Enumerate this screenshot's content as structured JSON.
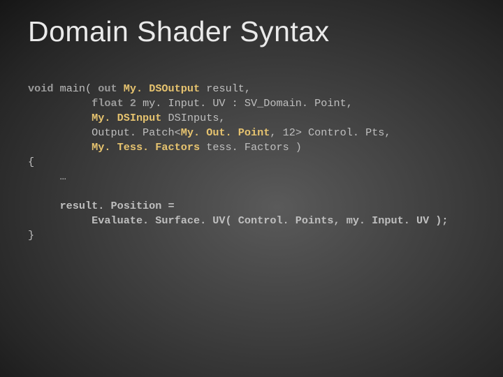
{
  "title": "Domain Shader Syntax",
  "code": {
    "l1a": "void",
    "l1b": " main( ",
    "l1c": "out ",
    "l1d": "My. DSOutput",
    "l1e": " result,",
    "l2a": "          ",
    "l2b": "float 2",
    "l2c": " my. Input. UV : SV_Domain. Point,",
    "l3a": "          ",
    "l3b": "My. DSInput",
    "l3c": " DSInputs,",
    "l4a": "          Output. Patch<",
    "l4b": "My. Out. Point",
    "l4c": ", 12> Control. Pts,",
    "l5a": "          ",
    "l5b": "My. Tess. Factors",
    "l5c": " tess. Factors )",
    "l6": "{",
    "l7a": "     …",
    "l8a": "     result. Position =",
    "l9a": "          Evaluate. Surface. UV( Control. Points, my. Input. UV );",
    "l10": "}"
  }
}
